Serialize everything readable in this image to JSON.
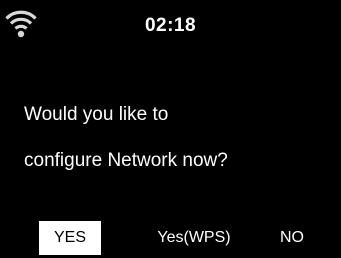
{
  "status_bar": {
    "wifi_icon": "wifi-icon",
    "time": "02:18"
  },
  "dialog": {
    "message_line1": "Would you like to",
    "message_line2": "configure Network now?"
  },
  "options": [
    {
      "label": "YES",
      "selected": true
    },
    {
      "label": "Yes(WPS)",
      "selected": false
    },
    {
      "label": "NO",
      "selected": false
    }
  ],
  "colors": {
    "background": "#000000",
    "text": "#ffffff",
    "highlight": "#ffffff",
    "highlight_text": "#000000"
  }
}
